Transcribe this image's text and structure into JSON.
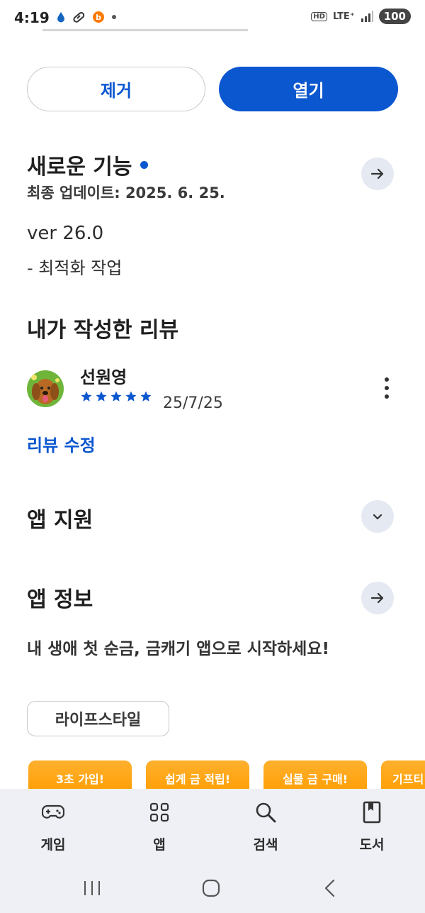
{
  "status_bar": {
    "time": "4:19",
    "hd": "HD",
    "network": "LTE⁺",
    "battery": "100"
  },
  "actions": {
    "remove_label": "제거",
    "open_label": "열기"
  },
  "whats_new": {
    "title": "새로운 기능",
    "last_updated": "최종 업데이트: 2025. 6. 25.",
    "version": "ver 26.0",
    "notes": "- 최적화 작업"
  },
  "my_review": {
    "title": "내가 작성한 리뷰",
    "reviewer_name": "선원영",
    "rating": 5,
    "date": "25/7/25",
    "edit_label": "리뷰 수정"
  },
  "app_support": {
    "title": "앱 지원"
  },
  "app_info": {
    "title": "앱 정보",
    "description": "내 생애 첫 순금, 금캐기 앱으로 시작하세요!",
    "category_chip": "라이프스타일"
  },
  "promos": [
    {
      "label": "3초 가입!"
    },
    {
      "label": "쉽게 금 적립!"
    },
    {
      "label": "실물 금 구매!"
    },
    {
      "label": "기프티"
    }
  ],
  "bottom_nav": {
    "items": [
      {
        "label": "게임",
        "icon": "gamepad-icon"
      },
      {
        "label": "앱",
        "icon": "apps-grid-icon"
      },
      {
        "label": "검색",
        "icon": "search-icon"
      },
      {
        "label": "도서",
        "icon": "book-icon"
      }
    ]
  },
  "colors": {
    "accent": "#0b57d0",
    "promo": "#ff9d00",
    "nav_background": "#eef0f6"
  }
}
